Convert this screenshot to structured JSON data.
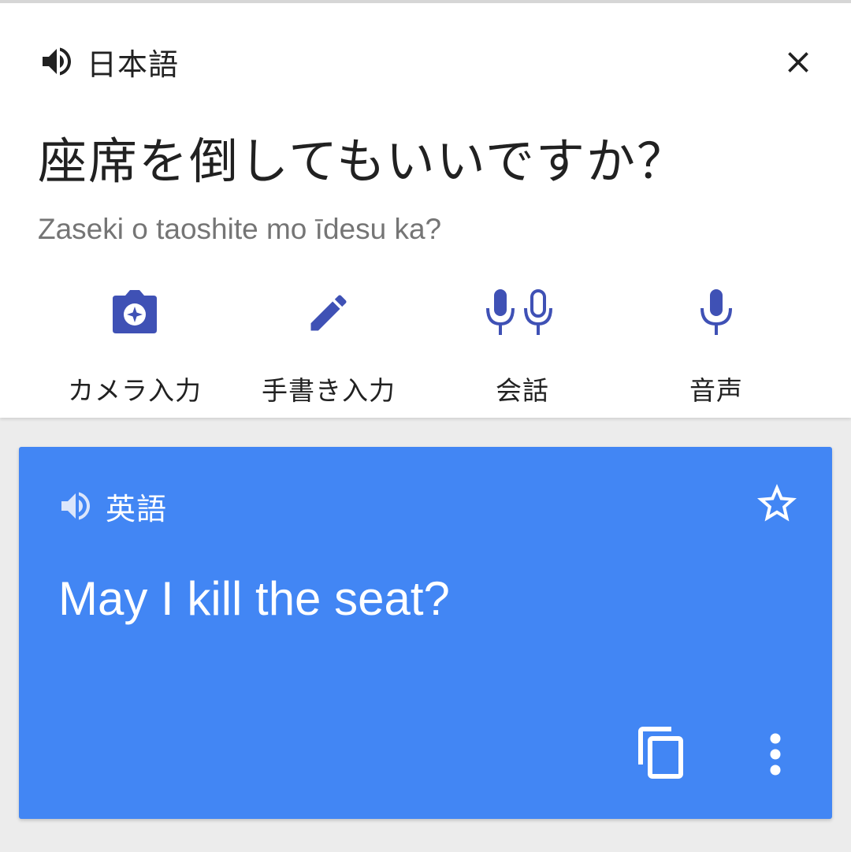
{
  "colors": {
    "accent": "#3f51b5",
    "result_bg": "#4286f4",
    "page_bg": "#ececec",
    "text_primary": "#212121",
    "text_secondary": "#757575"
  },
  "source": {
    "speaker_icon": "volume-up-icon",
    "language": "日本語",
    "close_icon": "close-icon",
    "text": "座席を倒してもいいですか？",
    "transliteration": "Zaseki o taoshite mo īdesu ka?"
  },
  "tools": [
    {
      "icon": "camera-icon",
      "label": "カメラ入力"
    },
    {
      "icon": "pen-icon",
      "label": "手書き入力"
    },
    {
      "icon": "conversation-mic-icon",
      "label": "会話"
    },
    {
      "icon": "mic-icon",
      "label": "音声"
    }
  ],
  "result": {
    "speaker_icon": "volume-up-icon",
    "language": "英語",
    "star_icon": "star-outline-icon",
    "text": "May I kill the seat?",
    "copy_icon": "copy-icon",
    "more_icon": "more-vert-icon"
  }
}
